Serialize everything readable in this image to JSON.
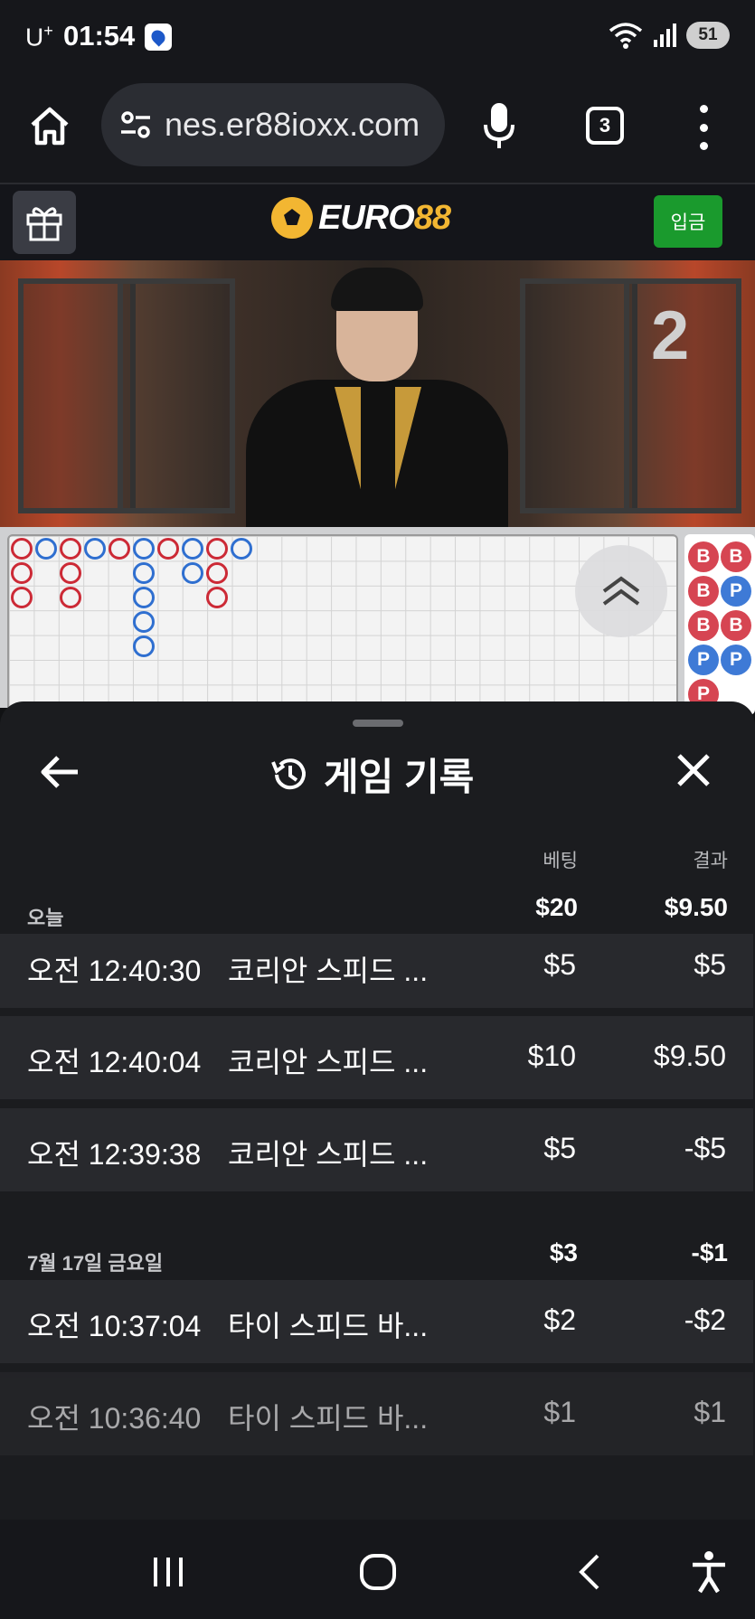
{
  "status_bar": {
    "carrier": "U",
    "carrier_plus": "+",
    "time": "01:54",
    "battery": "51"
  },
  "browser": {
    "url": "nes.er88ioxx.com",
    "tab_count": "3"
  },
  "site": {
    "logo_euro": "EURO",
    "logo_num": "88",
    "deposit_label": "입금",
    "table_number": "2"
  },
  "history": {
    "title": "게임 기록",
    "col_bet": "베팅",
    "col_result": "결과",
    "groups": [
      {
        "label": "오늘",
        "bet_total": "$20",
        "result_total": "$9.50",
        "rows": [
          {
            "time": "오전 12:40:30",
            "game": "코리안 스피드 ...",
            "bet": "$5",
            "result": "$5"
          },
          {
            "time": "오전 12:40:04",
            "game": "코리안 스피드 ...",
            "bet": "$10",
            "result": "$9.50"
          },
          {
            "time": "오전 12:39:38",
            "game": "코리안 스피드 ...",
            "bet": "$5",
            "result": "-$5"
          }
        ]
      },
      {
        "label": "7월 17일 금요일",
        "bet_total": "$3",
        "result_total": "-$1",
        "rows": [
          {
            "time": "오전 10:37:04",
            "game": "타이 스피드 바...",
            "bet": "$2",
            "result": "-$2"
          },
          {
            "time": "오전 10:36:40",
            "game": "타이 스피드 바...",
            "bet": "$1",
            "result": "$1"
          }
        ]
      }
    ]
  },
  "roadmap": {
    "bead_labels": [
      "B",
      "B",
      "B",
      "P",
      "B",
      "B",
      "P",
      "P",
      "P"
    ]
  }
}
